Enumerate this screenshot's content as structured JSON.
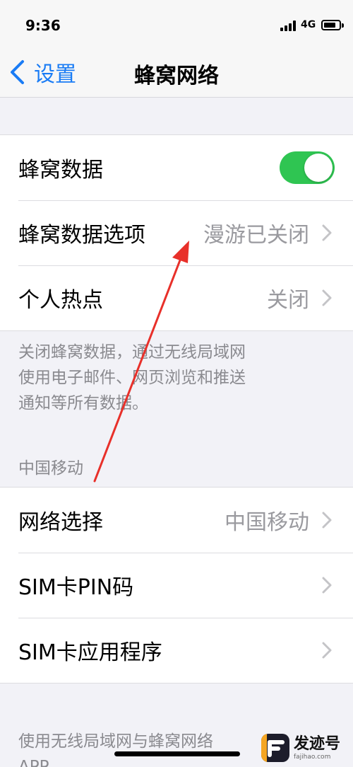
{
  "status_bar": {
    "time": "9:36",
    "network": "4G"
  },
  "nav": {
    "back_label": "设置",
    "title": "蜂窝网络"
  },
  "group1": {
    "cellular_data": {
      "label": "蜂窝数据",
      "enabled": true
    },
    "cellular_options": {
      "label": "蜂窝数据选项",
      "value": "漫游已关闭"
    },
    "hotspot": {
      "label": "个人热点",
      "value": "关闭"
    }
  },
  "group1_footer": {
    "lines": [
      "关闭蜂窝数据，通过无线局域网",
      "使用电子邮件、网页浏览和推送",
      "通知等所有数据。"
    ]
  },
  "carrier_header": "中国移动",
  "group2": {
    "network_selection": {
      "label": "网络选择",
      "value": "中国移动"
    },
    "sim_pin": {
      "label": "SIM卡PIN码"
    },
    "sim_apps": {
      "label": "SIM卡应用程序"
    }
  },
  "group2_footer": {
    "line1": "使用无线局域网与蜂窝网络",
    "line2": "APP"
  },
  "watermark": {
    "name": "发迹号",
    "url": "fajihao.com"
  },
  "colors": {
    "accent": "#1a7cf5",
    "toggle_on": "#2fc552",
    "annotation_arrow": "#e8302a"
  }
}
